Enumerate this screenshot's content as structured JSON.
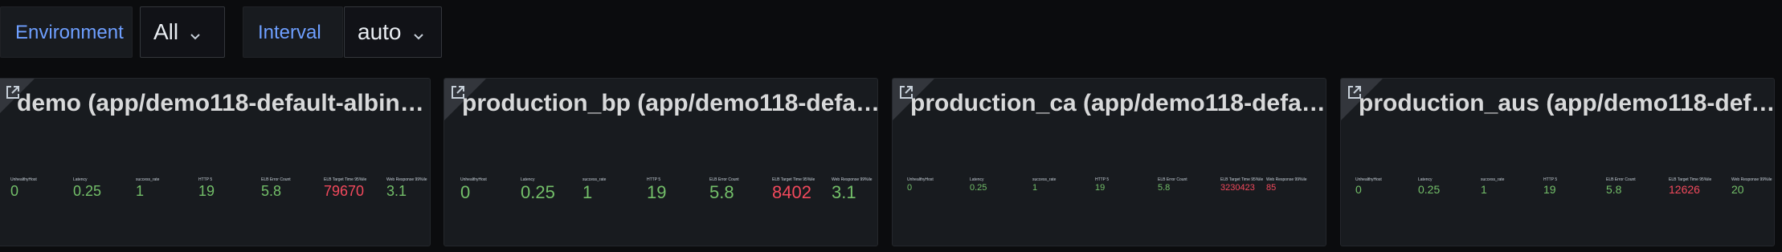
{
  "variables": {
    "environment": {
      "label": "Environment",
      "value": "All"
    },
    "interval": {
      "label": "Interval",
      "value": "auto"
    }
  },
  "colors": {
    "accent": "#6e9fff",
    "ok": "#73bf69",
    "alert": "#f2495c",
    "panel_bg": "#181b1f"
  },
  "panels": [
    {
      "title": "demo (app/demo118-default-albin…",
      "stats": [
        {
          "label": "UnhealthyHost",
          "value": "0",
          "status": "ok"
        },
        {
          "label": "Latency",
          "value": "0.25",
          "status": "ok"
        },
        {
          "label": "success_rate",
          "value": "1",
          "status": "ok"
        },
        {
          "label": "HTTP 5",
          "value": "19",
          "status": "ok"
        },
        {
          "label": "ELB Error Count",
          "value": "5.8",
          "status": "ok"
        },
        {
          "label": "ELB Target Time 95%ile",
          "value": "79670",
          "status": "alert"
        },
        {
          "label": "Web Response 99%ile",
          "value": "3.1",
          "status": "ok"
        }
      ]
    },
    {
      "title": "production_bp (app/demo118-defa…",
      "stats": [
        {
          "label": "UnhealthyHost",
          "value": "0",
          "status": "ok"
        },
        {
          "label": "Latency",
          "value": "0.25",
          "status": "ok"
        },
        {
          "label": "success_rate",
          "value": "1",
          "status": "ok"
        },
        {
          "label": "HTTP 5",
          "value": "19",
          "status": "ok"
        },
        {
          "label": "ELB Error Count",
          "value": "5.8",
          "status": "ok"
        },
        {
          "label": "ELB Target Time 95%ile",
          "value": "8402",
          "status": "alert"
        },
        {
          "label": "Web Response 99%ile",
          "value": "3.1",
          "status": "ok"
        }
      ]
    },
    {
      "title": "production_ca (app/demo118-defa…",
      "stats": [
        {
          "label": "UnhealthyHost",
          "value": "0",
          "status": "ok"
        },
        {
          "label": "Latency",
          "value": "0.25",
          "status": "ok"
        },
        {
          "label": "success_rate",
          "value": "1",
          "status": "ok"
        },
        {
          "label": "HTTP 5",
          "value": "19",
          "status": "ok"
        },
        {
          "label": "ELB Error Count",
          "value": "5.8",
          "status": "ok"
        },
        {
          "label": "ELB Target Time 95%ile",
          "value": "3230423",
          "status": "alert"
        },
        {
          "label": "Web Response 99%ile",
          "value": "85",
          "status": "alert"
        }
      ]
    },
    {
      "title": "production_aus (app/demo118-def…",
      "stats": [
        {
          "label": "UnhealthyHost",
          "value": "0",
          "status": "ok"
        },
        {
          "label": "Latency",
          "value": "0.25",
          "status": "ok"
        },
        {
          "label": "success_rate",
          "value": "1",
          "status": "ok"
        },
        {
          "label": "HTTP 5",
          "value": "19",
          "status": "ok"
        },
        {
          "label": "ELB Error Count",
          "value": "5.8",
          "status": "ok"
        },
        {
          "label": "ELB Target Time 95%ile",
          "value": "12626",
          "status": "alert"
        },
        {
          "label": "Web Response 99%ile",
          "value": "20",
          "status": "ok"
        }
      ]
    }
  ]
}
